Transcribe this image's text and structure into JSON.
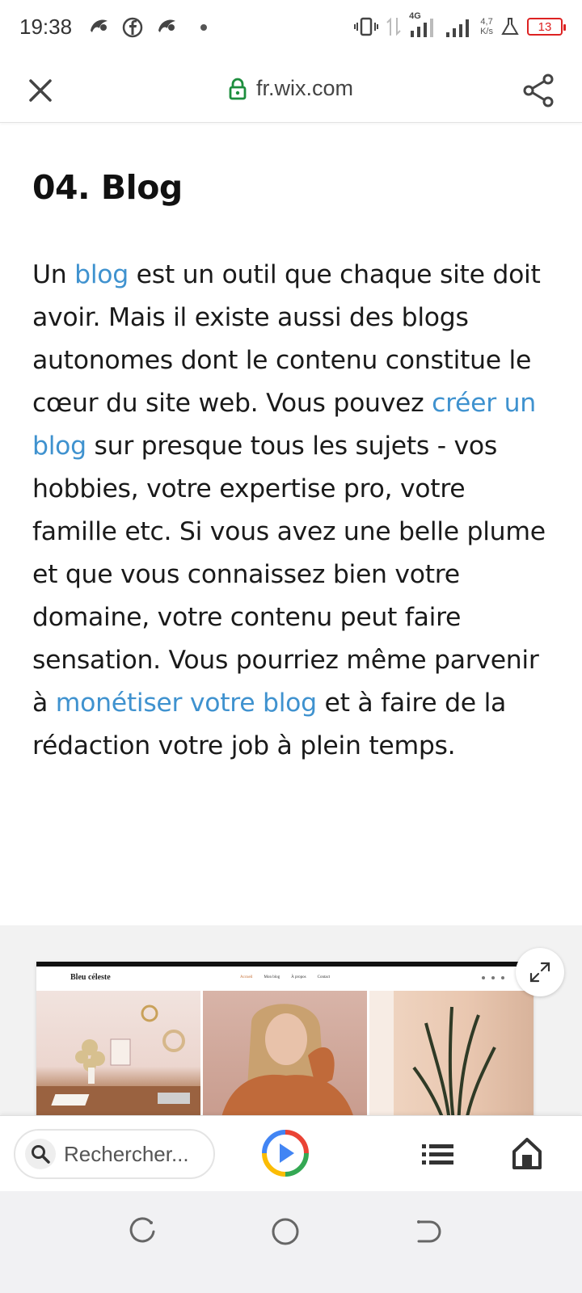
{
  "status_bar": {
    "time": "19:38",
    "network_type": "4G",
    "speed_value": "4,7",
    "speed_unit": "K/s",
    "battery": "13",
    "icons": [
      "app-icon",
      "facebook-icon",
      "app-icon",
      "notification-dot-icon",
      "vibrate-icon",
      "data-transfer-icon",
      "signal-icon",
      "signal-icon",
      "lab-icon",
      "battery-icon"
    ]
  },
  "app_bar": {
    "url": "fr.wix.com",
    "icons": [
      "close-icon",
      "lock-icon",
      "share-icon"
    ]
  },
  "article": {
    "heading": "04. Blog",
    "paragraph": [
      {
        "text": "Un ",
        "link": false
      },
      {
        "text": "blog",
        "link": true
      },
      {
        "text": " est un outil que chaque site doit avoir. Mais il existe aussi des blogs autonomes dont le contenu constitue le cœur du site web. Vous pouvez ",
        "link": false
      },
      {
        "text": "créer un blog",
        "link": true
      },
      {
        "text": " sur presque tous les sujets - vos hobbies, votre expertise pro, votre famille etc. Si vous avez une belle plume et que vous connaissez bien votre domaine, votre contenu peut faire sensation. Vous pourriez même parvenir à ",
        "link": false
      },
      {
        "text": "monétiser votre blog",
        "link": true
      },
      {
        "text": " et à faire de la rédaction votre job à plein temps.",
        "link": false
      }
    ],
    "link_color": "#3f92cf"
  },
  "preview": {
    "brand": "Bleu céleste",
    "menu": [
      "Accueil",
      "Mon blog",
      "À propos",
      "Contact"
    ],
    "icons": [
      "expand-icon"
    ]
  },
  "bottom_bar": {
    "search_placeholder": "Rechercher...",
    "icons": [
      "search-icon",
      "play-icon",
      "list-icon",
      "home-icon"
    ]
  },
  "system_nav": {
    "icons": [
      "recents-icon",
      "home-circle-icon",
      "back-icon"
    ]
  }
}
